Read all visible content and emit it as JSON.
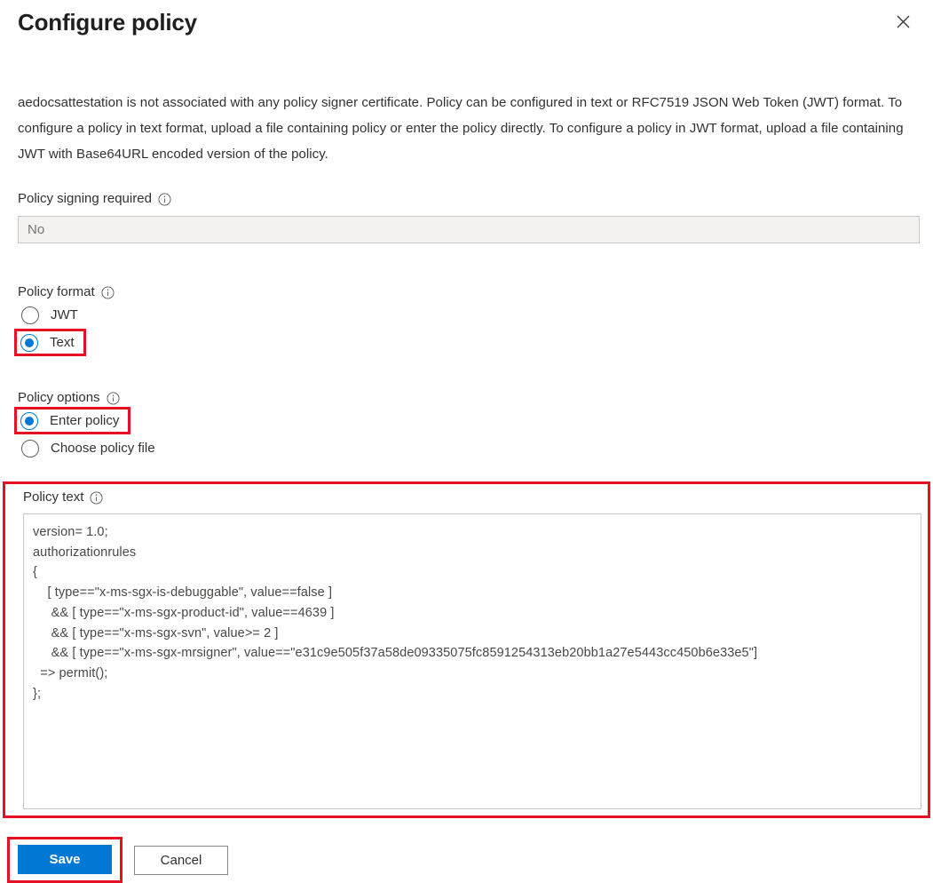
{
  "header": {
    "title": "Configure policy",
    "close_label": "Close",
    "close_icon": "close-icon"
  },
  "intro": {
    "text": "aedocsattestation is not associated with any policy signer certificate. Policy can be configured in text or RFC7519 JSON Web Token (JWT) format. To configure a policy in text format, upload a file containing policy or enter the policy directly. To configure a policy in JWT format, upload a file containing JWT with Base64URL encoded version of the policy."
  },
  "fields": {
    "policy_signing_required": {
      "label": "Policy signing required",
      "info_icon": "info-icon",
      "value": "No",
      "placeholder": "No",
      "readonly": true
    },
    "policy_format": {
      "label": "Policy format",
      "info_icon": "info-icon",
      "options": [
        {
          "label": "JWT",
          "selected": false,
          "highlighted": false
        },
        {
          "label": "Text",
          "selected": true,
          "highlighted": true
        }
      ]
    },
    "policy_options": {
      "label": "Policy options",
      "info_icon": "info-icon",
      "options": [
        {
          "label": "Enter policy",
          "selected": true,
          "highlighted": true
        },
        {
          "label": "Choose policy file",
          "selected": false,
          "highlighted": false
        }
      ]
    },
    "policy_text": {
      "label": "Policy text",
      "info_icon": "info-icon",
      "value": "version= 1.0;\nauthorizationrules\n{\n    [ type==\"x-ms-sgx-is-debuggable\", value==false ]\n     && [ type==\"x-ms-sgx-product-id\", value==4639 ]\n     && [ type==\"x-ms-sgx-svn\", value>= 2 ]\n     && [ type==\"x-ms-sgx-mrsigner\", value==\"e31c9e505f37a58de09335075fc8591254313eb20bb1a27e5443cc450b6e33e5\"]\n  => permit();\n};"
    }
  },
  "footer": {
    "save_label": "Save",
    "cancel_label": "Cancel"
  },
  "colors": {
    "accent": "#0078d4",
    "annotation": "#e81123",
    "text": "#323130",
    "disabled_bg": "#f3f2f1",
    "border": "#c8c6c4"
  }
}
